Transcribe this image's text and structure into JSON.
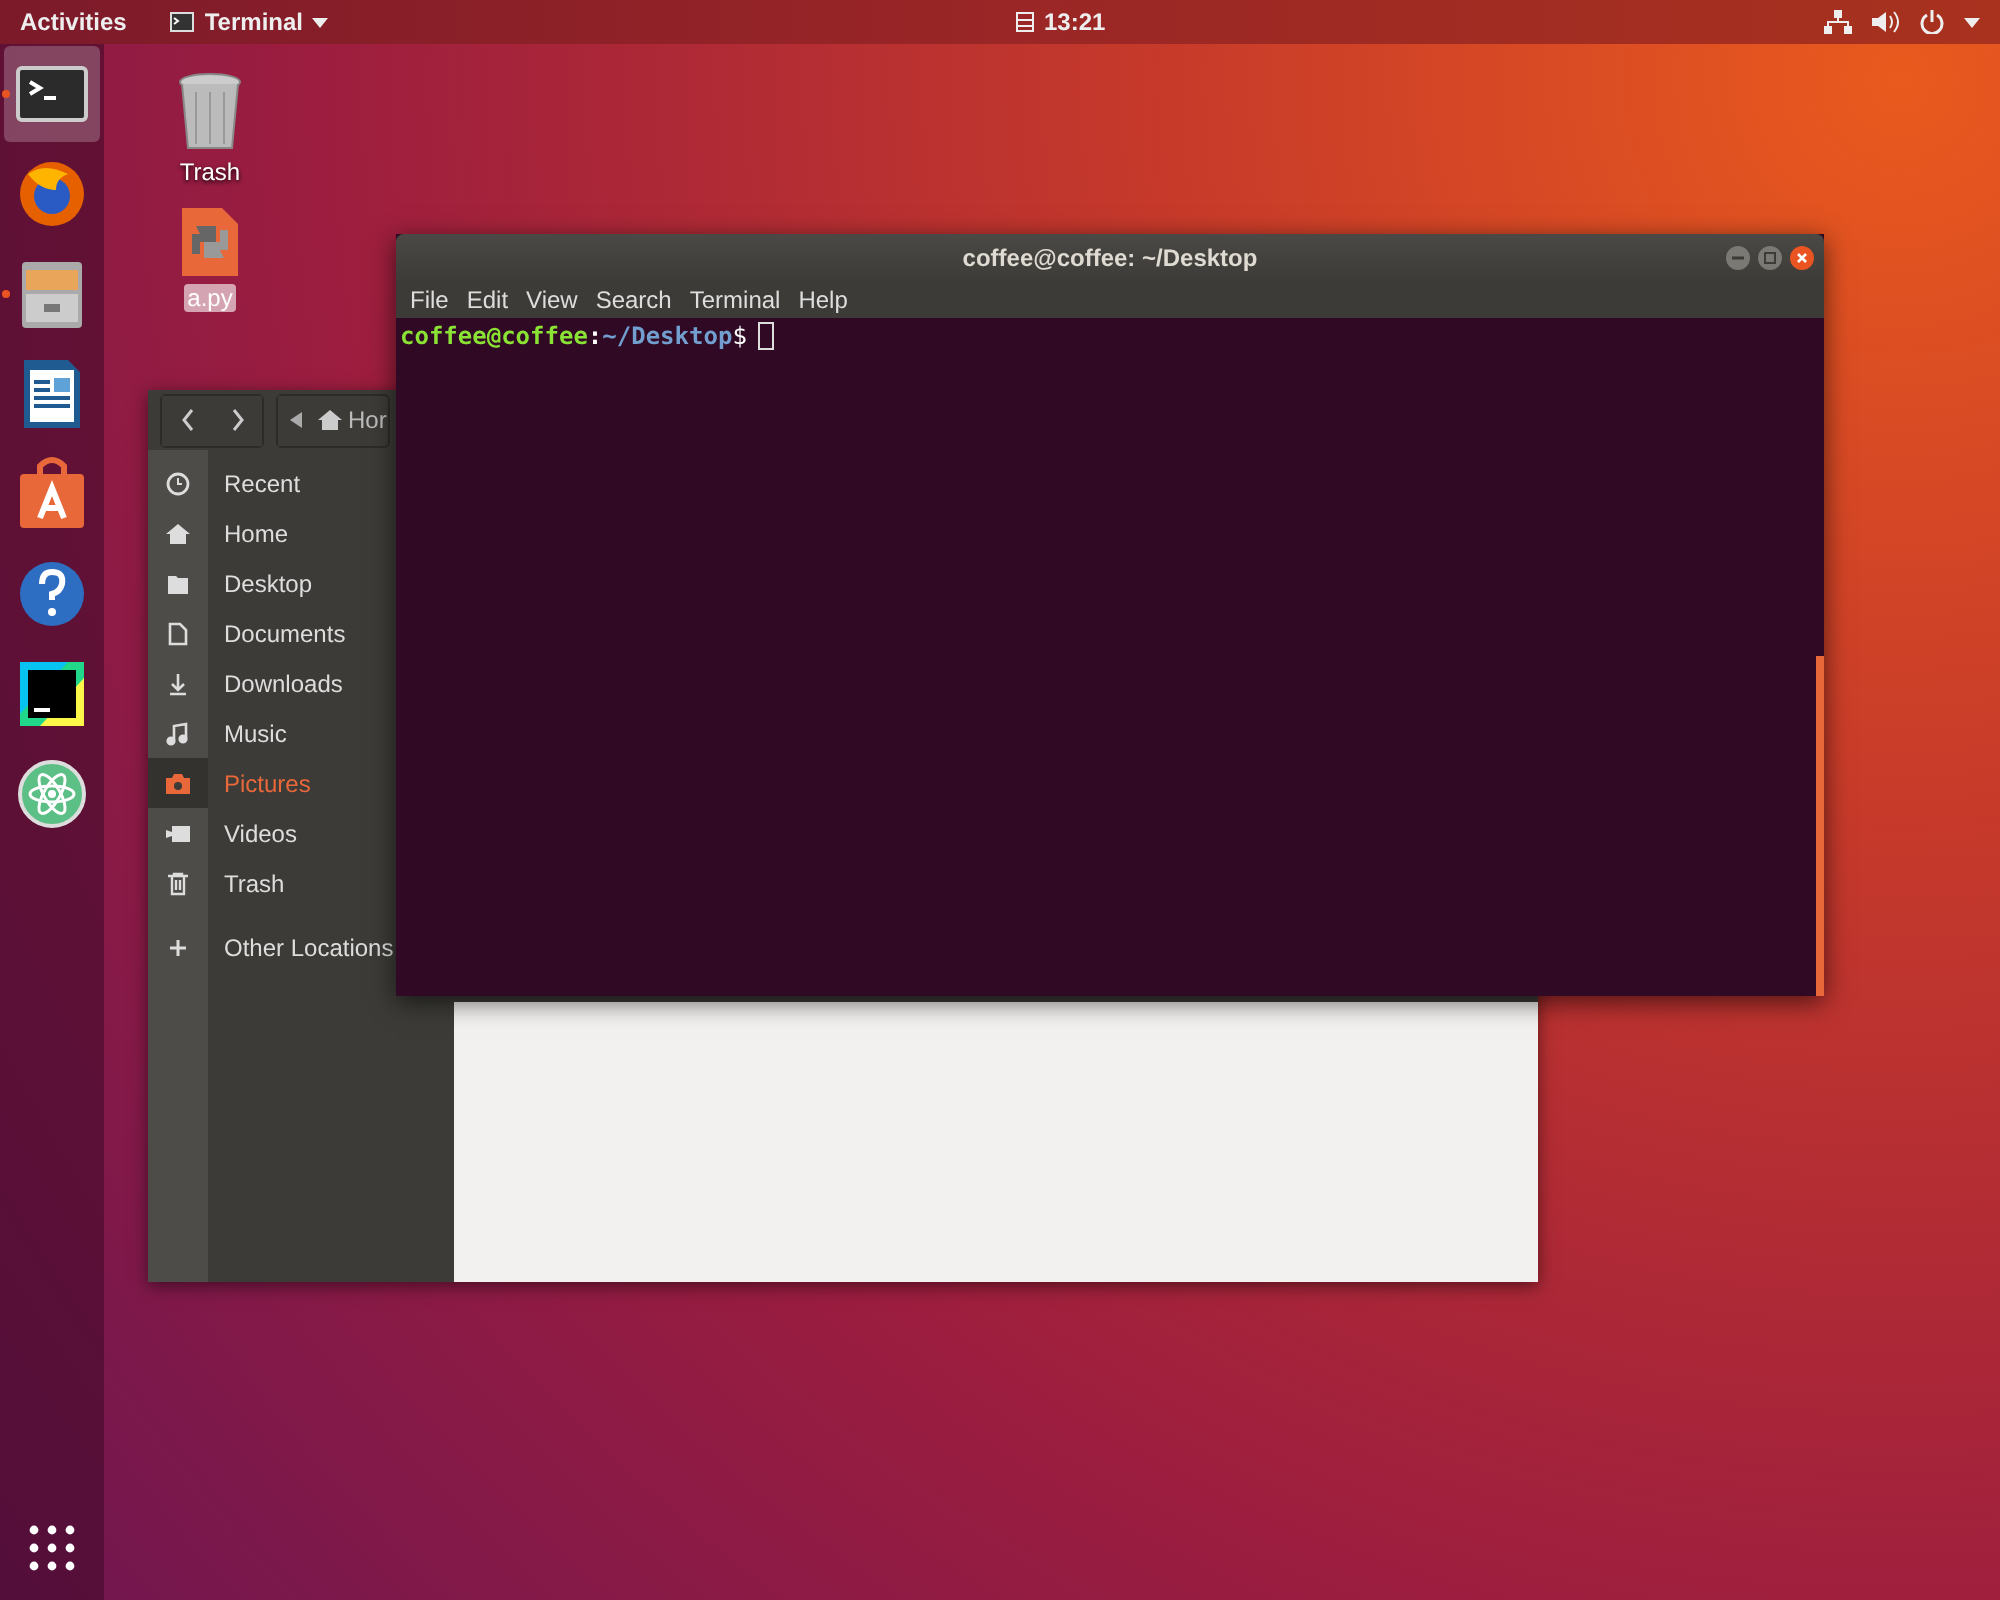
{
  "top_bar": {
    "activities": "Activities",
    "app_menu": "Terminal",
    "clock": "13:21"
  },
  "dock": [
    {
      "kind": "terminal",
      "running": true,
      "selected": true
    },
    {
      "kind": "browser",
      "running": false,
      "selected": false
    },
    {
      "kind": "files",
      "running": true,
      "selected": false
    },
    {
      "kind": "writer",
      "running": false,
      "selected": false
    },
    {
      "kind": "store",
      "running": false,
      "selected": false
    },
    {
      "kind": "help",
      "running": false,
      "selected": false
    },
    {
      "kind": "ide",
      "running": false,
      "selected": false
    },
    {
      "kind": "atom",
      "running": false,
      "selected": false
    }
  ],
  "desktop_icons": [
    {
      "kind": "trash",
      "label": "Trash",
      "selected": false
    },
    {
      "kind": "python",
      "label": "a.py",
      "selected": true
    }
  ],
  "file_manager": {
    "path": "Hor",
    "sidebar": [
      {
        "kind": "recent",
        "label": "Recent",
        "selected": false
      },
      {
        "kind": "home",
        "label": "Home",
        "selected": false
      },
      {
        "kind": "folder",
        "label": "Desktop",
        "selected": false
      },
      {
        "kind": "doc",
        "label": "Documents",
        "selected": false
      },
      {
        "kind": "download",
        "label": "Downloads",
        "selected": false
      },
      {
        "kind": "music",
        "label": "Music",
        "selected": false
      },
      {
        "kind": "camera",
        "label": "Pictures",
        "selected": true
      },
      {
        "kind": "video",
        "label": "Videos",
        "selected": false
      },
      {
        "kind": "trash",
        "label": "Trash",
        "selected": false
      },
      {
        "kind": "plus",
        "label": "Other Locations",
        "selected": false
      }
    ]
  },
  "terminal": {
    "title": "coffee@coffee: ~/Desktop",
    "menu": [
      "File",
      "Edit",
      "View",
      "Search",
      "Terminal",
      "Help"
    ],
    "prompt": {
      "user": "coffee@coffee",
      "separator": ":",
      "path": "~/Desktop",
      "symbol": "$"
    }
  }
}
